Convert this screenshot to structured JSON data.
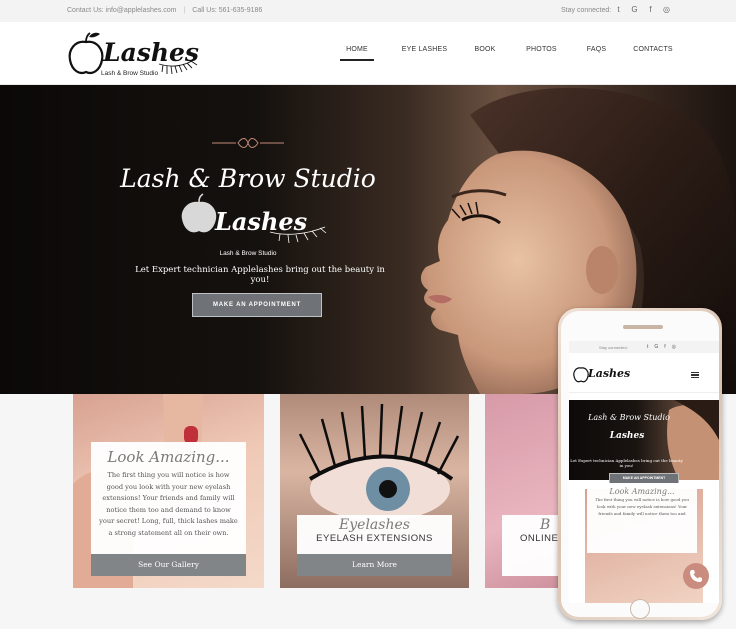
{
  "topbar": {
    "contact_email": "Contact Us: info@applelashes.com",
    "contact_phone": "Call Us: 561-635-9186",
    "stay_connected": "Stay connected:",
    "social_icons": [
      "twitter-icon",
      "google-plus-icon",
      "facebook-icon",
      "instagram-icon"
    ],
    "social_glyphs": [
      "t",
      "G",
      "f",
      "◎"
    ]
  },
  "brand": {
    "logo_text": "Lashes",
    "logo_sub": "Lash & Brow Studio"
  },
  "nav": {
    "items": [
      {
        "label": "HOME",
        "active": true
      },
      {
        "label": "EYE LASHES",
        "active": false
      },
      {
        "label": "BOOK",
        "active": false
      },
      {
        "label": "PHOTOS",
        "active": false
      },
      {
        "label": "FAQS",
        "active": false
      },
      {
        "label": "CONTACTS",
        "active": false
      }
    ]
  },
  "hero": {
    "script_title": "Lash & Brow Studio",
    "logo_text": "Lashes",
    "logo_sub": "Lash & Brow Studio",
    "tagline": "Let Expert technician Applelashes bring out the beauty in you!",
    "cta": "MAKE AN APPOINTMENT"
  },
  "cards": [
    {
      "script": "Look Amazing...",
      "text": "The first thing you will notice is how good you look with your new eyelash extensions! Your friends and family will notice them too and demand to know your secret! Long, full, thick lashes make a strong statement all on their own.",
      "button": "See Our Gallery"
    },
    {
      "script": "Eyelashes",
      "subtitle": "EYELASH EXTENSIONS",
      "button": "Learn More"
    },
    {
      "script": "B",
      "subtitle": "ONLINE"
    }
  ],
  "mobile": {
    "stay_connected": "Stay connected:",
    "tagline": "Let Expert technician Applelashes bring out the beauty in you!",
    "cta": "MAKE AN APPOINTMENT",
    "card_script": "Look Amazing...",
    "card_text": "The first thing you will notice is how good you look with your new eyelash extensions! Your friends and family will notice them too and"
  },
  "colors": {
    "accent_rose": "#c98c7e",
    "button_gray": "#828588",
    "hero_dark": "#0b0908"
  }
}
